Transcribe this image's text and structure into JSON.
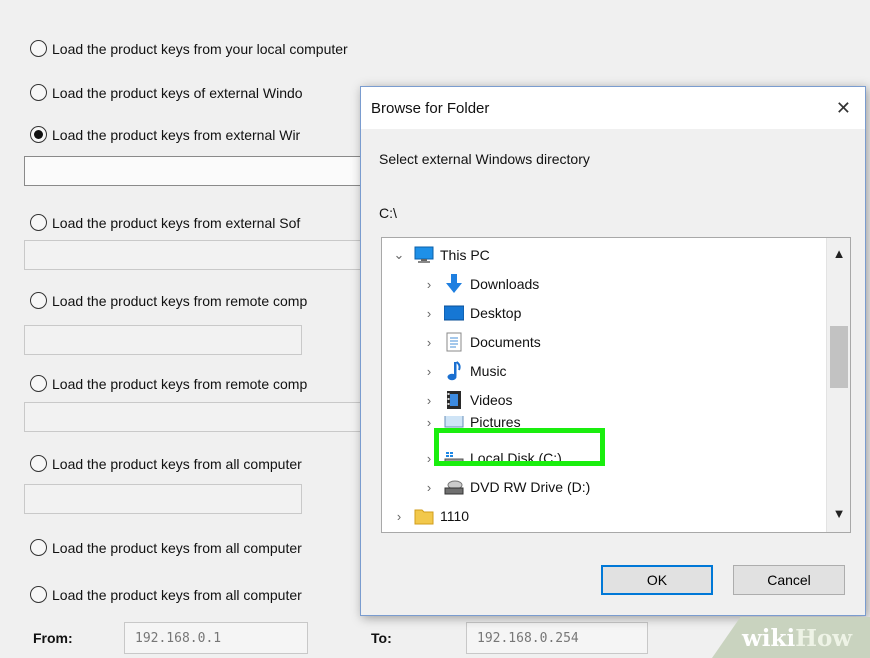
{
  "options": [
    {
      "label": "Load the product keys from your local computer",
      "selected": false
    },
    {
      "label": "Load the product keys of external Windo",
      "selected": false
    },
    {
      "label": "Load the product keys from external Wir",
      "selected": true
    },
    {
      "label": "Load the product keys from external Sof",
      "selected": false
    },
    {
      "label": "Load the product keys from remote comp",
      "selected": false
    },
    {
      "label": "Load the product keys from remote comp",
      "selected": false
    },
    {
      "label": "Load the product keys from all computer",
      "selected": false
    },
    {
      "label": "Load the product keys from all computer",
      "selected": false
    },
    {
      "label": "Load the product keys from all computer",
      "selected": false
    }
  ],
  "range": {
    "from_label": "From:",
    "from_value": "192.168.0.1",
    "to_label": "To:",
    "to_value": "192.168.0.254"
  },
  "dialog": {
    "title": "Browse for Folder",
    "close_glyph": "✕",
    "instruction": "Select external Windows directory",
    "current_path": "C:\\",
    "tree": [
      {
        "label": "This PC",
        "chevron": "⌄",
        "icon": "computer-icon"
      },
      {
        "label": "Downloads",
        "chevron": "›",
        "icon": "downloads-icon"
      },
      {
        "label": "Desktop",
        "chevron": "›",
        "icon": "desktop-icon"
      },
      {
        "label": "Documents",
        "chevron": "›",
        "icon": "documents-icon"
      },
      {
        "label": "Music",
        "chevron": "›",
        "icon": "music-icon"
      },
      {
        "label": "Videos",
        "chevron": "›",
        "icon": "videos-icon"
      },
      {
        "label": "Pictures",
        "chevron": "›",
        "icon": "pictures-icon"
      },
      {
        "label": "Local Disk (C:)",
        "chevron": "›",
        "icon": "local-disk-icon",
        "highlighted": true
      },
      {
        "label": "DVD RW Drive (D:)",
        "chevron": "›",
        "icon": "dvd-drive-icon"
      },
      {
        "label": "1110",
        "chevron": "›",
        "icon": "folder-icon"
      }
    ],
    "scroll_up": "▲",
    "scroll_down": "▼",
    "ok_label": "OK",
    "cancel_label": "Cancel"
  },
  "watermark": {
    "prefix": "wiki",
    "suffix": "How"
  },
  "colors": {
    "highlight": "#1aee0e",
    "accent": "#0078d7"
  }
}
